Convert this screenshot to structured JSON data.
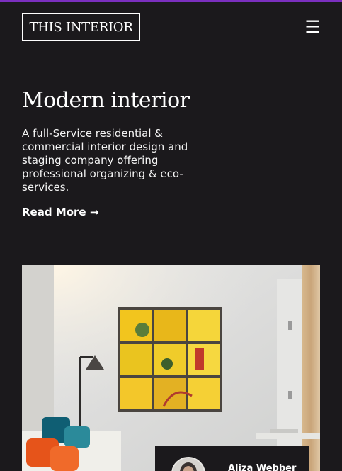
{
  "header": {
    "logo_text": "THIS INTERIOR",
    "menu_icon": "hamburger-menu-icon",
    "menu_glyph": "☰"
  },
  "hero": {
    "title": "Modern interior",
    "description": "A full-Service residential & commercial interior design and staging company offering professional organizing & eco-services.",
    "read_more_label": "Read More →"
  },
  "featured": {
    "image_icon": "interior-photo",
    "author_name": "Aliza Webber"
  },
  "colors": {
    "background": "#1b191c",
    "accent_bar": "#7b2fbf",
    "text": "#ffffff"
  }
}
